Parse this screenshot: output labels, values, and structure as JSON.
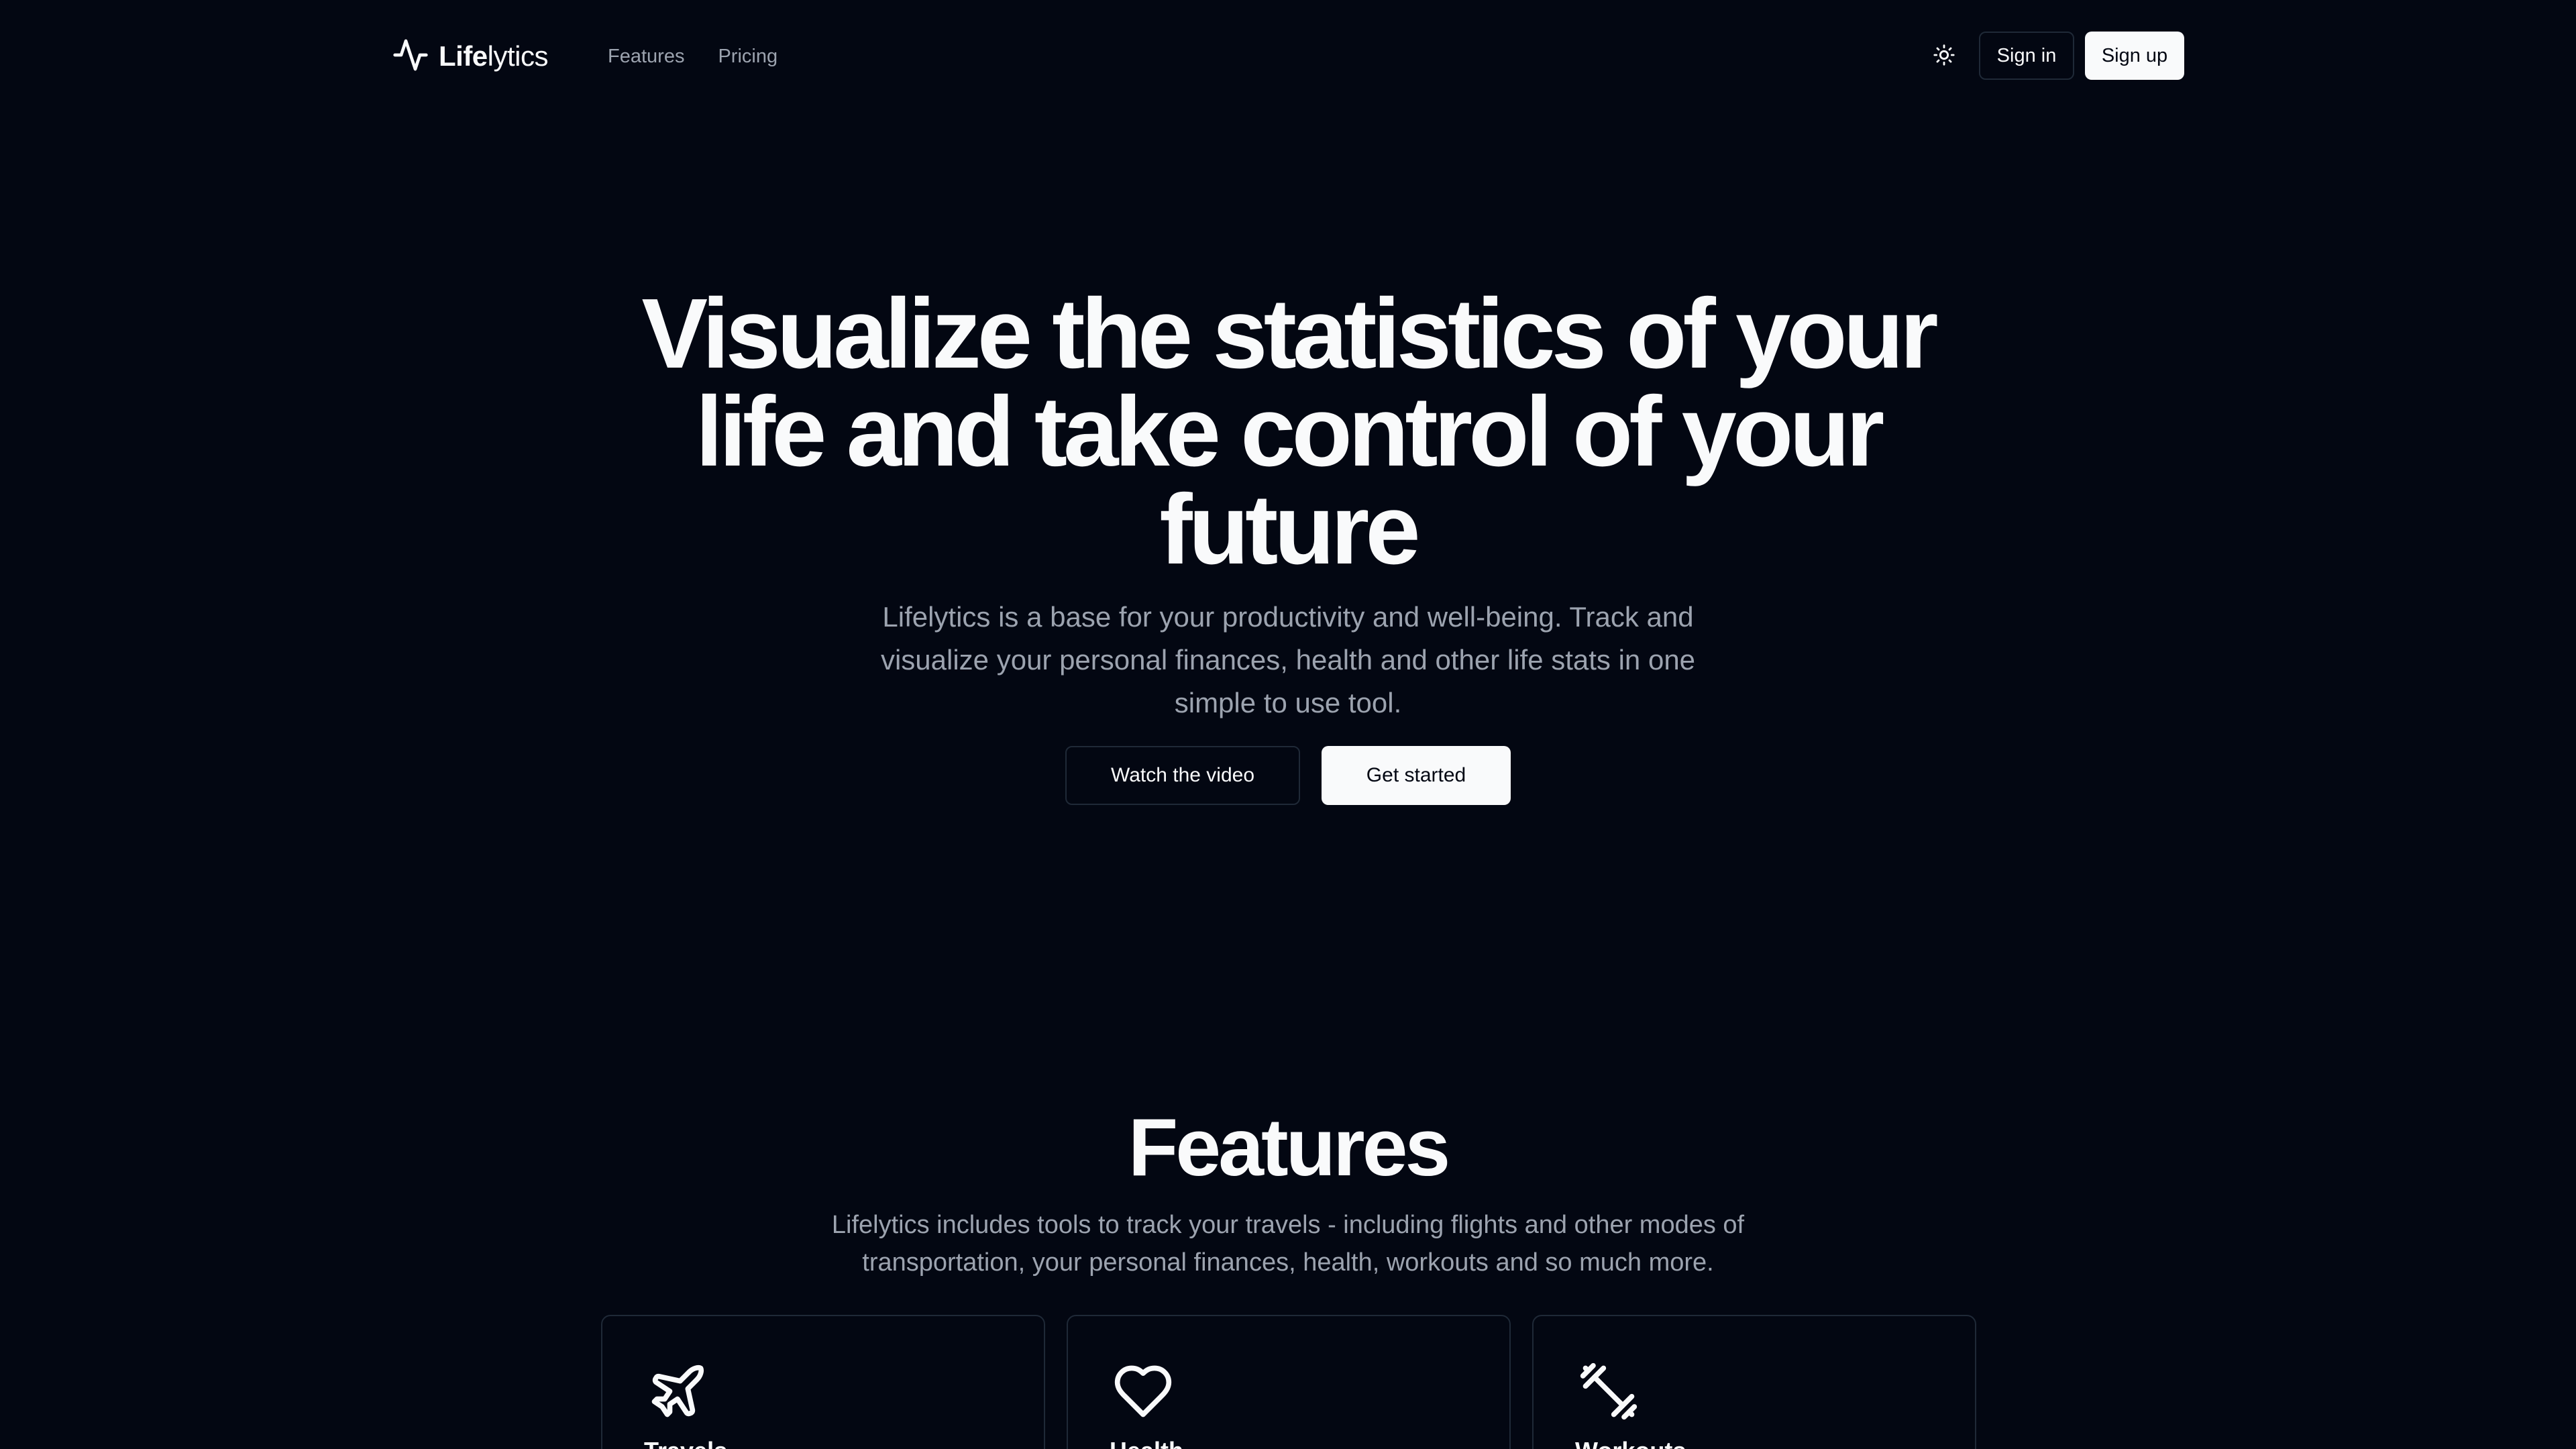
{
  "header": {
    "brand_bold": "Life",
    "brand_rest": "lytics",
    "nav": [
      "Features",
      "Pricing"
    ],
    "signin_label": "Sign in",
    "signup_label": "Sign up",
    "icons": {
      "logo": "activity-icon",
      "theme_toggle": "sun-icon"
    }
  },
  "hero": {
    "title": "Visualize the statistics of your life and take control of your future",
    "subtitle": "Lifelytics is a base for your productivity and well-being. Track and visualize your personal finances, health and other life stats in one simple to use tool.",
    "watch_label": "Watch the video",
    "start_label": "Get started"
  },
  "features": {
    "title": "Features",
    "subtitle": "Lifelytics includes tools to track your travels - including flights and other modes of transportation, your personal finances, health, workouts and so much more.",
    "cards": [
      {
        "icon": "plane-icon",
        "title": "Travels"
      },
      {
        "icon": "heart-icon",
        "title": "Health"
      },
      {
        "icon": "dumbbell-icon",
        "title": "Workouts"
      }
    ]
  },
  "colors": {
    "background": "#030712",
    "foreground": "#f9fafb",
    "muted": "#9ca3af",
    "border": "#1f2937"
  }
}
